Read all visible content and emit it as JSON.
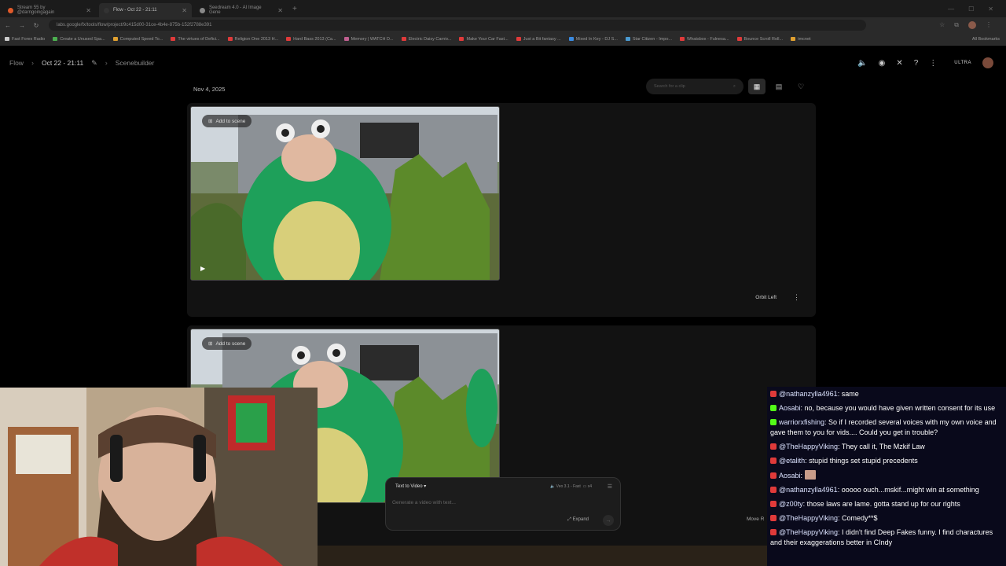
{
  "browser": {
    "tabs": [
      {
        "label": "Stream 55 by @darngoingagain",
        "color": "#e05a2a",
        "active": false
      },
      {
        "label": "Flow - Oct 22 - 21:11",
        "color": "#333333",
        "active": true
      },
      {
        "label": "Seedream 4.0 - AI Image Gene",
        "color": "#888888",
        "active": false
      }
    ],
    "url": "labs.google/fx/tools/flow/project/9c415d00-31ce-4b4e-875b-152f2788e391",
    "bookmarks": [
      {
        "label": "Fast Forex Radio",
        "color": "#cccccc"
      },
      {
        "label": "Create a Unused Spa...",
        "color": "#4caf50"
      },
      {
        "label": "Computed Speed To...",
        "color": "#e0a030"
      },
      {
        "label": "The virtues of Defici...",
        "color": "#e03a3a"
      },
      {
        "label": "Religion One 2013 H...",
        "color": "#e03a3a"
      },
      {
        "label": "Hard Bass 2013 (Ca...",
        "color": "#e03a3a"
      },
      {
        "label": "Memory | WATCH D...",
        "color": "#c06090"
      },
      {
        "label": "Electric Daisy Carniv...",
        "color": "#e03a3a"
      },
      {
        "label": "Make Your Car Fast...",
        "color": "#e03a3a"
      },
      {
        "label": "Just a Bit fantasy ...",
        "color": "#e03a3a"
      },
      {
        "label": "Mixed In Key - DJ S...",
        "color": "#3a8ae0"
      },
      {
        "label": "Star Citizen - Impo...",
        "color": "#4a9ad0"
      },
      {
        "label": "Whatsbox - Fulnesa...",
        "color": "#e03a3a"
      },
      {
        "label": "Bounce Scroll Roll...",
        "color": "#e03a3a"
      },
      {
        "label": "tmcnet",
        "color": "#e0a030"
      }
    ],
    "all_bookmarks": "All Bookmarks"
  },
  "header": {
    "app": "Flow",
    "project": "Oct 22 - 21:11",
    "page": "Scenebuilder",
    "tier": "ULTRA"
  },
  "toolbar": {
    "date": "Nov 4, 2025",
    "search_placeholder": "Search for a clip"
  },
  "clips": [
    {
      "add_label": "Add to scene",
      "title": "Orbit Left"
    },
    {
      "add_label": "Add to scene"
    }
  ],
  "composer": {
    "mode": "Text to Video",
    "model": "Veo 3.1 - Fast",
    "count": "x4",
    "placeholder": "Generate a video with text...",
    "expand": "Expand"
  },
  "move_label": "Move R",
  "chat": [
    {
      "platform": "yt",
      "user": "@nathanzylla4961",
      "text": "same"
    },
    {
      "platform": "kick",
      "user": "Aosabi",
      "text": "no, because you would have given written consent for its use"
    },
    {
      "platform": "kick",
      "user": "warriorxfishing",
      "text": "So if I recorded several voices with my own voice and gave them to you for vids.... Could you get in trouble?"
    },
    {
      "platform": "yt",
      "user": "@TheHappyViking",
      "text": "They call it, The Mzkif Law"
    },
    {
      "platform": "yt",
      "user": "@etalith",
      "text": "stupid things set stupid precedents"
    },
    {
      "platform": "yt",
      "user": "Aosabi",
      "text": "",
      "emote": true
    },
    {
      "platform": "yt",
      "user": "@nathanzylla4961",
      "text": "ooooo ouch...mskif...might win at something"
    },
    {
      "platform": "yt",
      "user": "@z00ty",
      "text": "those laws are lame. gotta stand up for our rights"
    },
    {
      "platform": "yt",
      "user": "@TheHappyViking",
      "text": "Comedy**$"
    },
    {
      "platform": "yt",
      "user": "@TheHappyViking",
      "text": "I didn't find Deep Fakes funny. I find charactures and their exaggerations better in CIndy"
    }
  ]
}
